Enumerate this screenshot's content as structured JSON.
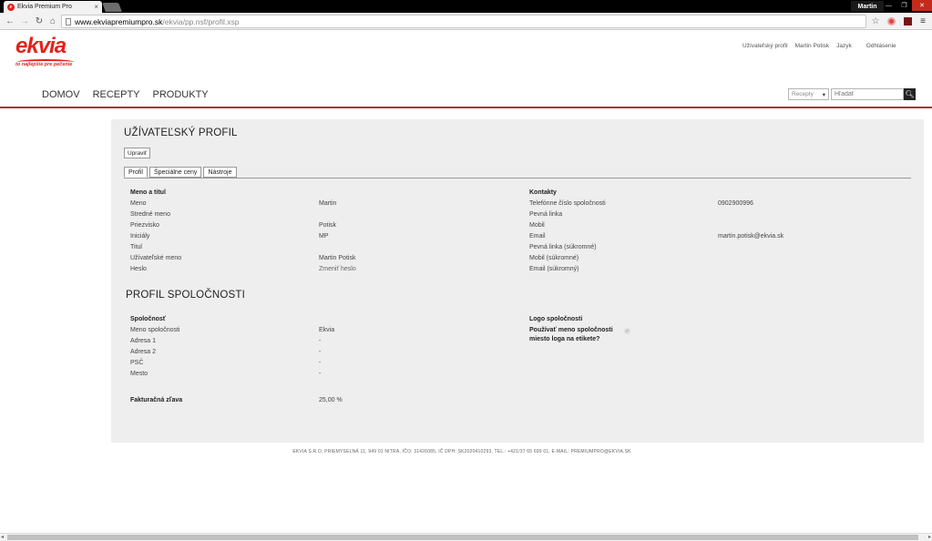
{
  "browser": {
    "tab_title": "Ekvia Premium Pro",
    "tab_close": "×",
    "favicon": "e",
    "user": "Martin",
    "url_host": "www.ekviapremiumpro.sk",
    "url_path": "/ekvia/pp.nsf/profil.xsp",
    "icons": [
      "back-icon",
      "forward-icon",
      "reload-icon",
      "home-icon",
      "star-icon",
      "extension-icon",
      "menu-icon"
    ]
  },
  "header": {
    "logo_text": "ekvia",
    "logo_tagline": "to najlepšie pre pečenie",
    "top_links": [
      "Užívateľský profil",
      "Martin Potisk",
      "Jazyk",
      "Odhlásenie"
    ],
    "nav": [
      "DOMOV",
      "RECEPTY",
      "PRODUKTY"
    ],
    "search_select": "Recepty",
    "search_placeholder": "Hľadať"
  },
  "profile": {
    "title": "UŽÍVATEĽSKÝ PROFIL",
    "edit_label": "Upraviť",
    "tabs": [
      "Profil",
      "Špeciálne ceny",
      "Nástroje"
    ],
    "name_section": {
      "heading": "Meno a titul",
      "rows": [
        {
          "label": "Meno",
          "value": "Martin"
        },
        {
          "label": "Stredné meno",
          "value": ""
        },
        {
          "label": "Priezvisko",
          "value": "Potisk"
        },
        {
          "label": "Iniciály",
          "value": "MP"
        },
        {
          "label": "Titul",
          "value": ""
        },
        {
          "label": "Užívateľské meno",
          "value": "Martin Potisk"
        },
        {
          "label": "Heslo",
          "value": "Zmeniť heslo"
        }
      ]
    },
    "contacts_section": {
      "heading": "Kontakty",
      "rows": [
        {
          "label": "Telefónne číslo spoločnosti",
          "value": "0902900996"
        },
        {
          "label": "Pevná linka",
          "value": ""
        },
        {
          "label": "Mobil",
          "value": ""
        },
        {
          "label": "Email",
          "value": "martin.potisk@ekvia.sk"
        },
        {
          "label": "Pevná linka (súkromné)",
          "value": ""
        },
        {
          "label": "Mobil (súkromné)",
          "value": ""
        },
        {
          "label": "Email (súkromný)",
          "value": ""
        }
      ]
    }
  },
  "company": {
    "title": "PROFIL SPOLOČNOSTI",
    "section_heading": "Spoločnosť",
    "rows": [
      {
        "label": "Meno spoločnosti",
        "value": "Ekvia"
      },
      {
        "label": "Adresa 1",
        "value": "-"
      },
      {
        "label": "Adresa 2",
        "value": "-"
      },
      {
        "label": "PSČ",
        "value": "-"
      },
      {
        "label": "Mesto",
        "value": "-"
      }
    ],
    "discount_label": "Fakturačná zľava",
    "discount_value": "25,00 %",
    "logo_heading": "Logo spoločnosti",
    "logo_question_line1": "Používať meno spoločnosti",
    "logo_question_line2": "miesto loga na etikete?",
    "logo_checked": "✓"
  },
  "footer": {
    "text": "EKVIA S.R.O. PRIEMYSELNÁ 11, 949 01 NITRA, IČO: 31426085, IČ DPH: SK2020410293, TEL.: +421/37 65 699 01, E-MAIL: PREMIUMPRO@EKVIA.SK"
  }
}
